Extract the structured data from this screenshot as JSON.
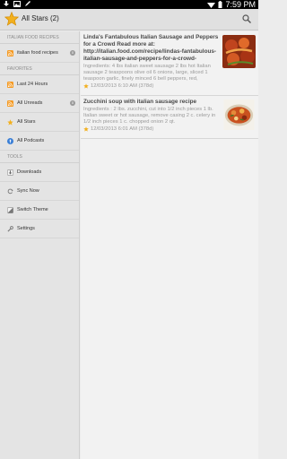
{
  "status_bar": {
    "time": "7:59 PM"
  },
  "action_bar": {
    "title": "All Stars (2)"
  },
  "sidebar": {
    "sections": [
      {
        "title": "ITALIAN FOOD RECIPES",
        "items": [
          {
            "label": "italian food recipes",
            "badge": "0"
          }
        ]
      },
      {
        "title": "FAVORITES",
        "items": [
          {
            "label": "Last 24 Hours"
          },
          {
            "label": "All Unreads",
            "badge": "0"
          },
          {
            "label": "All Stars"
          },
          {
            "label": "All Podcasts"
          }
        ]
      },
      {
        "title": "TOOLS",
        "items": [
          {
            "label": "Downloads"
          },
          {
            "label": "Sync Now"
          },
          {
            "label": "Switch Theme"
          },
          {
            "label": "Settings"
          }
        ]
      }
    ]
  },
  "articles": [
    {
      "title": "Linda's Fantabulous Italian Sausage and Peppers for a Crowd Read more at: http://italian.food.com/recipe/lindas-fantabulous-italian-sausage-and-peppers-for-a-crowd-",
      "summary": "Ingredients: 4 lbs italian sweet sausage 2 lbs hot Italian sausage 2 teaspoons olive oil 6 onions, large, sliced 1 teaspoon garlic, finely minced 6 bell peppers, red,",
      "meta": "12/03/2013 6:10 AM (378d)"
    },
    {
      "title": "Zucchini soup with italian sausage recipe",
      "summary": "Ingredients : 2 lbs. zucchini, cut into 1/2 inch pieces 1 lb. Italian sweet or hot sausage, remove casing 2 c. celery in 1/2 inch pieces 1 c. chopped onion 2 qt.",
      "meta": "12/03/2013 6:01 AM (378d)"
    }
  ],
  "colors": {
    "star": "#f2b01e",
    "rss": "#f59a23",
    "podcast": "#3b7fd6"
  }
}
